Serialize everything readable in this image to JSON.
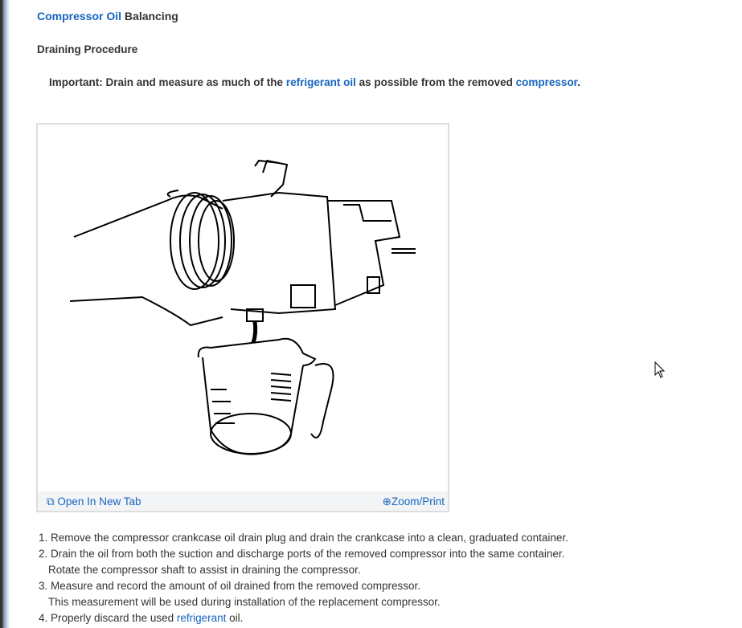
{
  "header": {
    "title_link": "Compressor Oil",
    "title_rest": " Balancing",
    "section": "Draining Procedure"
  },
  "important": {
    "prefix": "Important: Drain and measure as much of the ",
    "link1": "refrigerant oil",
    "middle": " as possible from the removed ",
    "link2": "compressor",
    "suffix": "."
  },
  "figure": {
    "open_tab": "Open In New Tab",
    "zoom_print": "Zoom/Print",
    "open_icon": "open-in-new-tab-icon",
    "zoom_icon": "zoom-in-icon"
  },
  "steps": [
    {
      "line": "1. Remove the compressor crankcase oil drain plug and drain the crankcase into a clean, graduated container."
    },
    {
      "line": "2. Drain the oil from both the suction and discharge ports of the removed compressor into the same container.",
      "sub": "Rotate the compressor shaft to assist in draining the compressor."
    },
    {
      "line": "3. Measure and record the amount of oil drained from the removed compressor.",
      "sub": "This measurement will be used during installation of the replacement compressor."
    },
    {
      "prefix": "4. Properly discard the used ",
      "link": "refrigerant",
      "suffix": " oil."
    }
  ]
}
